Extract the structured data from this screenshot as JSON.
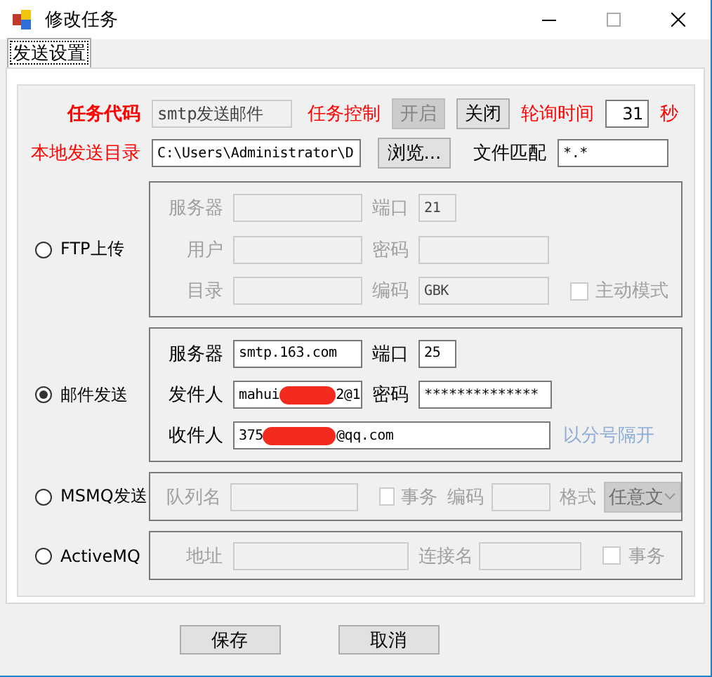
{
  "window": {
    "title": "修改任务"
  },
  "tabs": [
    {
      "label": "发送设置",
      "selected": true
    }
  ],
  "task": {
    "code_label": "任务代码",
    "code_value": "smtp发送邮件",
    "control_label": "任务控制",
    "start_button": {
      "label": "开启",
      "disabled": true
    },
    "stop_button": {
      "label": "关闭",
      "disabled": false
    },
    "poll_label": "轮询时间",
    "poll_value": "31",
    "poll_unit": "秒",
    "dir_label": "本地发送目录",
    "dir_value": "C:\\Users\\Administrator\\D",
    "browse_button": "浏览...",
    "match_label": "文件匹配",
    "match_value": "*.*"
  },
  "modes": [
    {
      "kind": "ftp",
      "label": "FTP上传",
      "selected": false,
      "rows": [
        [
          {
            "kind": "label",
            "text": "服务器"
          },
          {
            "kind": "input"
          },
          {
            "kind": "label",
            "text": "端口"
          },
          {
            "kind": "input",
            "value": "21"
          }
        ],
        [
          {
            "kind": "label",
            "text": "用户"
          },
          {
            "kind": "input"
          },
          {
            "kind": "label",
            "text": "密码"
          },
          {
            "kind": "input"
          }
        ],
        [
          {
            "kind": "label",
            "text": "目录"
          },
          {
            "kind": "input"
          },
          {
            "kind": "label",
            "text": "编码"
          },
          {
            "kind": "input",
            "value": "GBK"
          },
          {
            "kind": "checkbox",
            "text": "主动模式",
            "checked": false
          }
        ]
      ]
    },
    {
      "kind": "mail",
      "label": "邮件发送",
      "selected": true,
      "rows": [
        [
          {
            "kind": "label",
            "text": "服务器"
          },
          {
            "kind": "input",
            "value": "smtp.163.com"
          },
          {
            "kind": "label",
            "text": "端口"
          },
          {
            "kind": "input",
            "value": "25"
          }
        ],
        [
          {
            "kind": "label",
            "text": "发件人"
          },
          {
            "kind": "redacted_input",
            "value_start": "mahui",
            "value_end": "2@1"
          },
          {
            "kind": "label",
            "text": "密码"
          },
          {
            "kind": "input",
            "value": "**************"
          }
        ],
        [
          {
            "kind": "label",
            "text": "收件人"
          },
          {
            "kind": "redacted_input",
            "value_start": "375",
            "value_end": "@qq.com"
          },
          {
            "kind": "hint",
            "text": "以分号隔开"
          }
        ]
      ]
    },
    {
      "kind": "msmq",
      "label": "MSMQ发送",
      "selected": false,
      "rows": [
        [
          {
            "kind": "label",
            "text": "队列名"
          },
          {
            "kind": "input"
          },
          {
            "kind": "checkbox",
            "text": "事务",
            "checked": false
          },
          {
            "kind": "label",
            "text": "编码"
          },
          {
            "kind": "input"
          },
          {
            "kind": "label",
            "text": "格式"
          },
          {
            "kind": "select",
            "value": "任意文"
          }
        ]
      ]
    },
    {
      "kind": "activemq",
      "label": "ActiveMQ",
      "selected": false,
      "rows": [
        [
          {
            "kind": "label",
            "text": "地址"
          },
          {
            "kind": "input"
          },
          {
            "kind": "label",
            "text": "连接名"
          },
          {
            "kind": "input"
          },
          {
            "kind": "checkbox",
            "text": "事务",
            "checked": false
          }
        ]
      ]
    }
  ],
  "buttons": [
    {
      "label": "保存"
    },
    {
      "label": "取消"
    }
  ]
}
